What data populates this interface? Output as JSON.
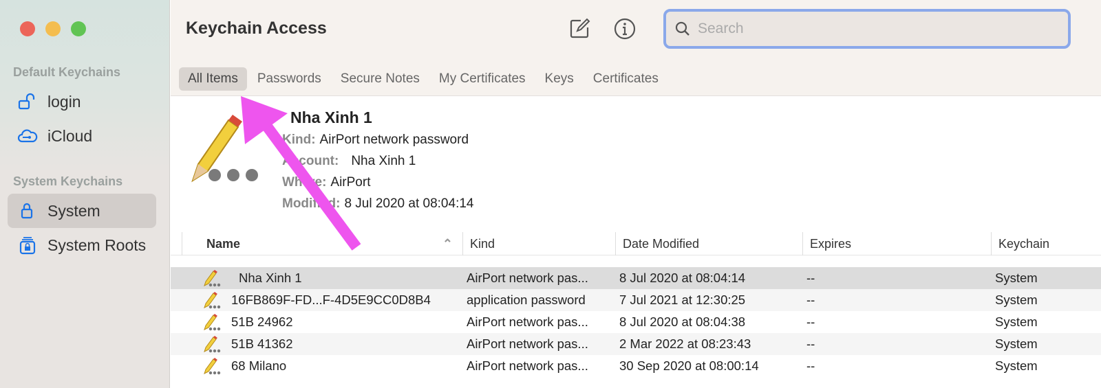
{
  "window": {
    "title": "Keychain Access"
  },
  "sidebar": {
    "default_header": "Default Keychains",
    "system_header": "System Keychains",
    "items": [
      {
        "label": "login"
      },
      {
        "label": "iCloud"
      },
      {
        "label": "System"
      },
      {
        "label": "System Roots"
      }
    ]
  },
  "search": {
    "placeholder": "Search"
  },
  "tabs": [
    {
      "label": "All Items"
    },
    {
      "label": "Passwords"
    },
    {
      "label": "Secure Notes"
    },
    {
      "label": "My Certificates"
    },
    {
      "label": "Keys"
    },
    {
      "label": "Certificates"
    }
  ],
  "detail": {
    "name": "Nha Xinh 1",
    "kind_label": "Kind:",
    "kind": "AirPort network password",
    "account_label": "Account:",
    "account": "Nha Xinh 1",
    "where_label": "Where:",
    "where": "AirPort",
    "modified_label": "Modified:",
    "modified": "8 Jul 2020 at 08:04:14"
  },
  "columns": [
    "Name",
    "Kind",
    "Date Modified",
    "Expires",
    "Keychain"
  ],
  "rows": [
    {
      "name": "Nha Xinh 1",
      "kind": "AirPort network pas...",
      "date": "8 Jul 2020 at 08:04:14",
      "expires": "--",
      "keychain": "System"
    },
    {
      "name": "16FB869F-FD...F-4D5E9CC0D8B4",
      "kind": "application password",
      "date": "7 Jul 2021 at 12:30:25",
      "expires": "--",
      "keychain": "System"
    },
    {
      "name": "51B 24962",
      "kind": "AirPort network pas...",
      "date": "8 Jul 2020 at 08:04:38",
      "expires": "--",
      "keychain": "System"
    },
    {
      "name": "51B 41362",
      "kind": "AirPort network pas...",
      "date": "2 Mar 2022 at 08:23:43",
      "expires": "--",
      "keychain": "System"
    },
    {
      "name": "68 Milano",
      "kind": "AirPort network pas...",
      "date": "30 Sep 2020 at 08:00:14",
      "expires": "--",
      "keychain": "System"
    }
  ],
  "colors": {
    "accent": "#1a73e8",
    "annotation_arrow": "#ee55ee"
  }
}
